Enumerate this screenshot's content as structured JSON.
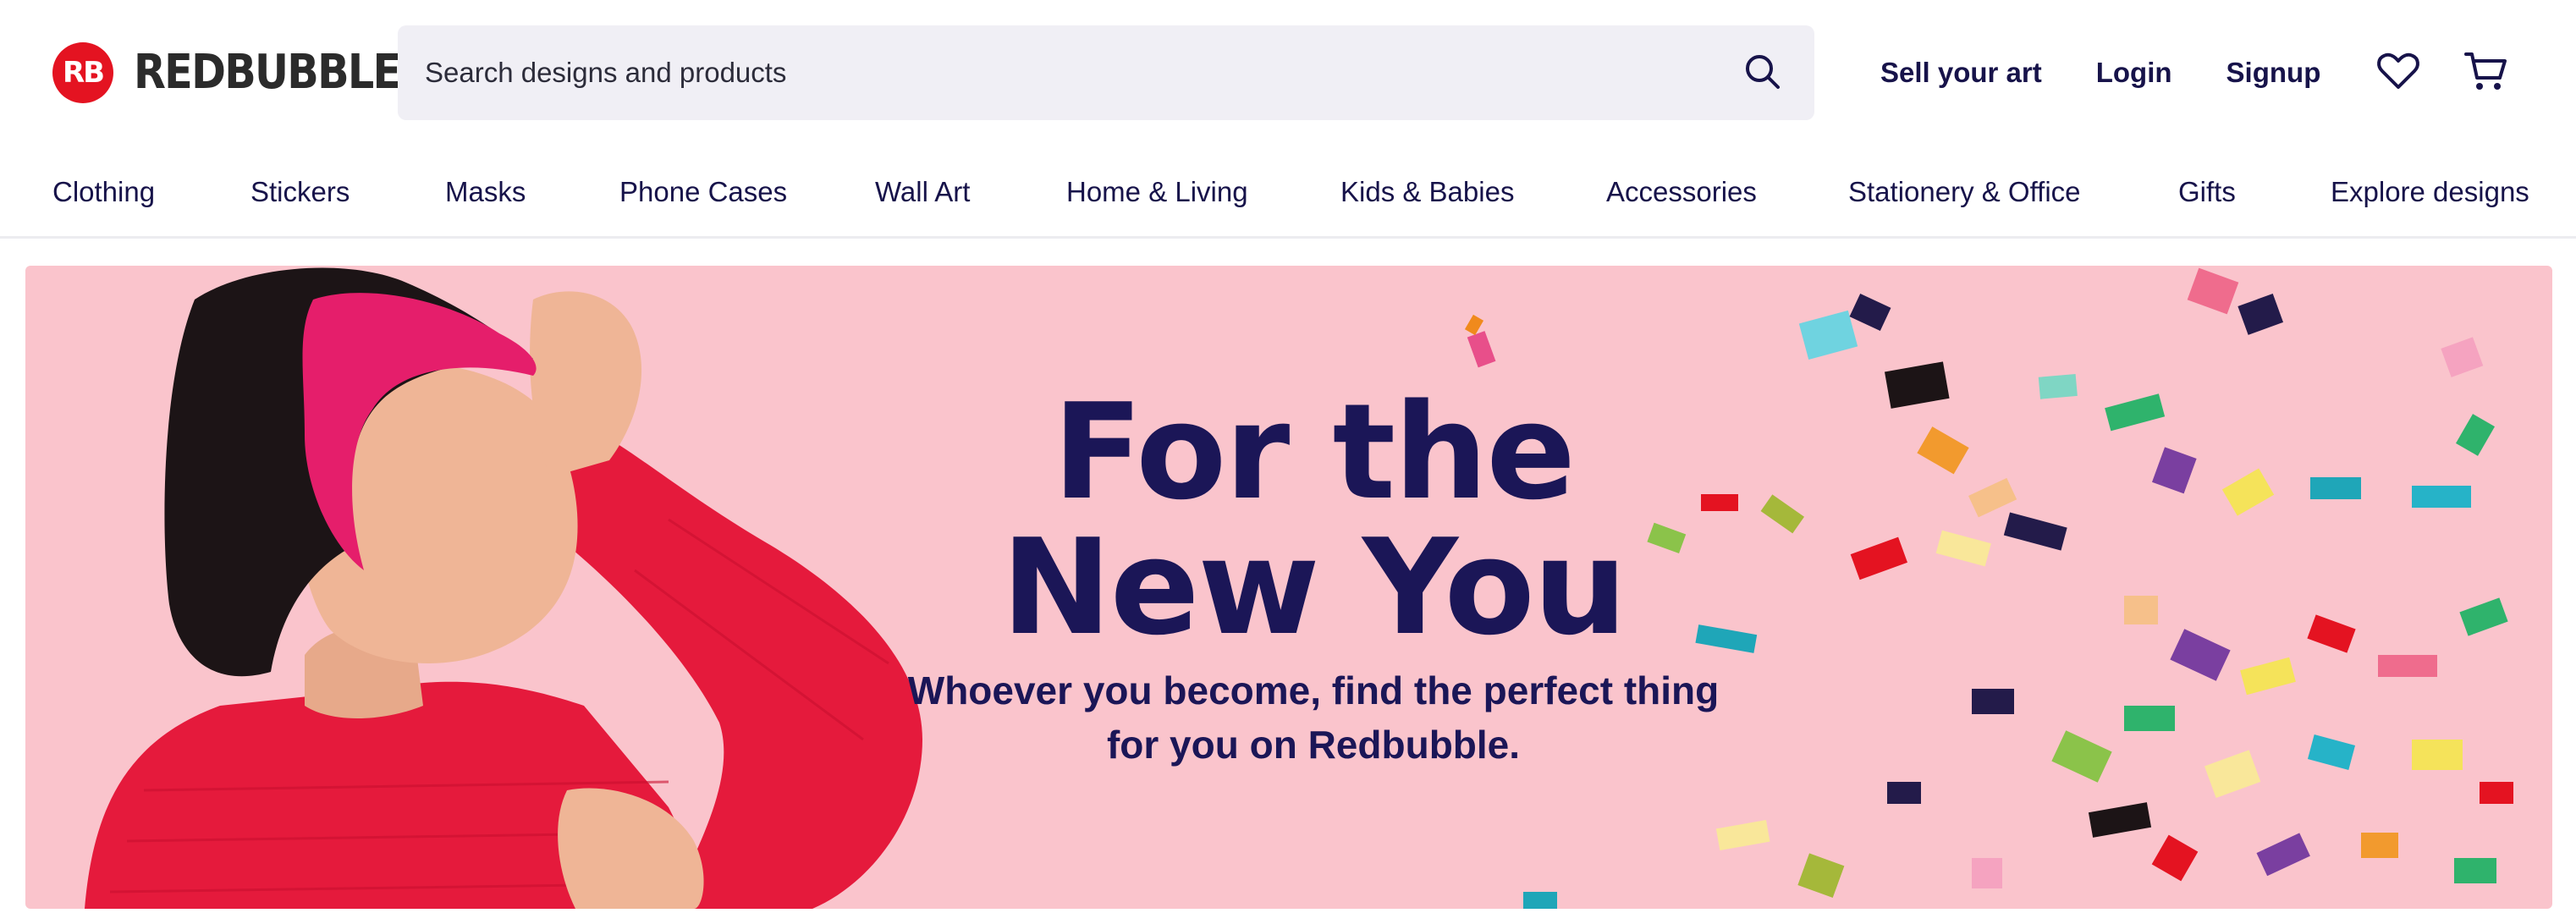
{
  "brand": {
    "logo_mark": "RB",
    "name": "REDBUBBLE",
    "color": "#e41321"
  },
  "search": {
    "placeholder": "Search designs and products",
    "icon": "search-icon"
  },
  "header_links": {
    "sell": "Sell your art",
    "login": "Login",
    "signup": "Signup",
    "wishlist_icon": "heart-icon",
    "cart_icon": "cart-icon"
  },
  "nav": {
    "items": [
      "Clothing",
      "Stickers",
      "Masks",
      "Phone Cases",
      "Wall Art",
      "Home & Living",
      "Kids & Babies",
      "Accessories",
      "Stationery & Office",
      "Gifts",
      "Explore designs"
    ]
  },
  "hero": {
    "title_line1": "For the",
    "title_line2": "New You",
    "subtitle_line1": "Whoever you become, find the perfect thing",
    "subtitle_line2": "for you on Redbubble.",
    "background": "#fac4cc",
    "text_color": "#1b1657"
  }
}
